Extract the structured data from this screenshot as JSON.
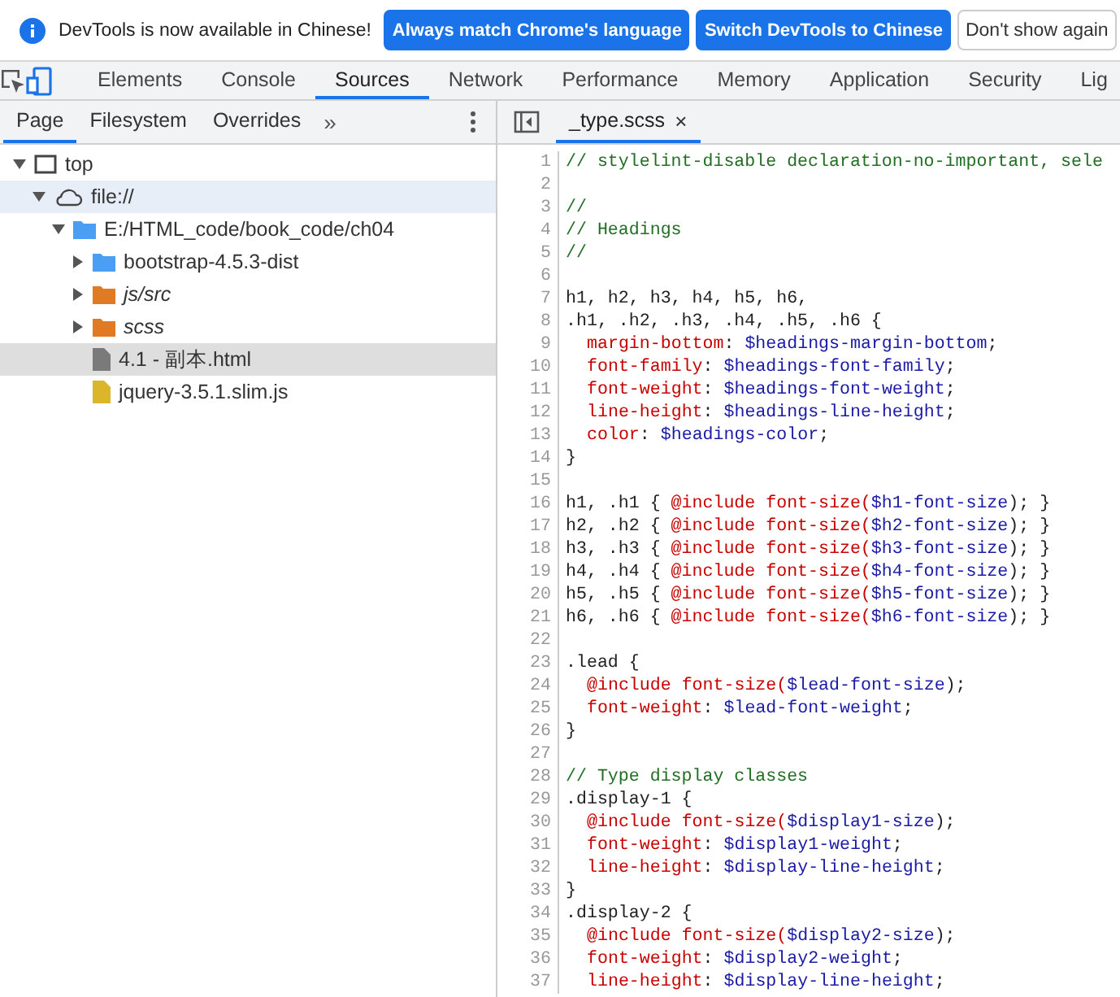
{
  "infobar": {
    "message": "DevTools is now available in Chinese!",
    "buttons": [
      {
        "label": "Always match Chrome's language",
        "kind": "primary"
      },
      {
        "label": "Switch DevTools to Chinese",
        "kind": "primary"
      },
      {
        "label": "Don't show again",
        "kind": "secondary"
      }
    ]
  },
  "main_tabs": [
    {
      "label": "Elements",
      "selected": false
    },
    {
      "label": "Console",
      "selected": false
    },
    {
      "label": "Sources",
      "selected": true
    },
    {
      "label": "Network",
      "selected": false
    },
    {
      "label": "Performance",
      "selected": false
    },
    {
      "label": "Memory",
      "selected": false
    },
    {
      "label": "Application",
      "selected": false
    },
    {
      "label": "Security",
      "selected": false
    },
    {
      "label": "Lig",
      "selected": false
    }
  ],
  "navigator": {
    "tabs": [
      {
        "label": "Page",
        "selected": true
      },
      {
        "label": "Filesystem",
        "selected": false
      },
      {
        "label": "Overrides",
        "selected": false
      }
    ],
    "more": "»",
    "tree": [
      {
        "kind": "frame",
        "label": "top",
        "expanded": true,
        "selected": false,
        "hovered": false,
        "italic": false,
        "children": [
          {
            "kind": "cloud",
            "label": "file://",
            "expanded": true,
            "selected": true,
            "hovered": false,
            "italic": false,
            "children": [
              {
                "kind": "folder",
                "label": "E:/HTML_code/book_code/ch04",
                "color": "#4a9ff5",
                "expanded": true,
                "selected": false,
                "hovered": false,
                "italic": false,
                "children": [
                  {
                    "kind": "folder",
                    "label": "bootstrap-4.5.3-dist",
                    "color": "#4a9ff5",
                    "expanded": false,
                    "selected": false,
                    "hovered": false,
                    "italic": false
                  },
                  {
                    "kind": "folder",
                    "label": "js/src",
                    "color": "#e07b24",
                    "expanded": false,
                    "selected": false,
                    "hovered": false,
                    "italic": true
                  },
                  {
                    "kind": "folder",
                    "label": "scss",
                    "color": "#e07b24",
                    "expanded": false,
                    "selected": false,
                    "hovered": false,
                    "italic": true
                  },
                  {
                    "kind": "file",
                    "label": "4.1 - 副本.html",
                    "color": "#7a7a7a",
                    "selected": false,
                    "hovered": true,
                    "italic": false
                  },
                  {
                    "kind": "file",
                    "label": "jquery-3.5.1.slim.js",
                    "color": "#dcb62a",
                    "selected": false,
                    "hovered": false,
                    "italic": false
                  }
                ]
              }
            ]
          }
        ]
      }
    ]
  },
  "editor": {
    "tabs": [
      {
        "label": "_type.scss",
        "close": "×",
        "selected": true
      }
    ],
    "lines": [
      {
        "number": "1",
        "tokens": [
          {
            "kind": "comment",
            "text": "// stylelint-disable declaration-no-important, sele"
          }
        ]
      },
      {
        "number": "2"
      },
      {
        "number": "3",
        "tokens": [
          {
            "kind": "comment",
            "text": "//"
          }
        ]
      },
      {
        "number": "4",
        "tokens": [
          {
            "kind": "comment",
            "text": "// Headings"
          }
        ]
      },
      {
        "number": "5",
        "tokens": [
          {
            "kind": "comment",
            "text": "//"
          }
        ]
      },
      {
        "number": "6"
      },
      {
        "number": "7",
        "tokens": [
          {
            "kind": "plain",
            "text": "h1, h2, h3, h4, h5, h6,"
          }
        ]
      },
      {
        "number": "8",
        "tokens": [
          {
            "kind": "plain",
            "text": ".h1, .h2, .h3, .h4, .h5, .h6 {"
          }
        ]
      },
      {
        "number": "9",
        "indented": true,
        "tokens": [
          {
            "kind": "property",
            "text": "margin-bottom"
          },
          {
            "kind": "plain",
            "text": ": "
          },
          {
            "kind": "variable",
            "text": "$headings-margin-bottom"
          },
          {
            "kind": "plain",
            "text": ";"
          }
        ]
      },
      {
        "number": "10",
        "indented": true,
        "tokens": [
          {
            "kind": "property",
            "text": "font-family"
          },
          {
            "kind": "plain",
            "text": ": "
          },
          {
            "kind": "variable",
            "text": "$headings-font-family"
          },
          {
            "kind": "plain",
            "text": ";"
          }
        ]
      },
      {
        "number": "11",
        "indented": true,
        "tokens": [
          {
            "kind": "property",
            "text": "font-weight"
          },
          {
            "kind": "plain",
            "text": ": "
          },
          {
            "kind": "variable",
            "text": "$headings-font-weight"
          },
          {
            "kind": "plain",
            "text": ";"
          }
        ]
      },
      {
        "number": "12",
        "indented": true,
        "tokens": [
          {
            "kind": "property",
            "text": "line-height"
          },
          {
            "kind": "plain",
            "text": ": "
          },
          {
            "kind": "variable",
            "text": "$headings-line-height"
          },
          {
            "kind": "plain",
            "text": ";"
          }
        ]
      },
      {
        "number": "13",
        "indented": true,
        "tokens": [
          {
            "kind": "property",
            "text": "color"
          },
          {
            "kind": "plain",
            "text": ": "
          },
          {
            "kind": "variable",
            "text": "$headings-color"
          },
          {
            "kind": "plain",
            "text": ";"
          }
        ]
      },
      {
        "number": "14",
        "tokens": [
          {
            "kind": "plain",
            "text": "}"
          }
        ]
      },
      {
        "number": "15"
      },
      {
        "number": "16",
        "tokens": [
          {
            "kind": "plain",
            "text": "h1, .h1 { "
          },
          {
            "kind": "property",
            "text": "@include font-size("
          },
          {
            "kind": "variable",
            "text": "$h1-font-size"
          },
          {
            "kind": "plain",
            "text": "); }"
          }
        ]
      },
      {
        "number": "17",
        "tokens": [
          {
            "kind": "plain",
            "text": "h2, .h2 { "
          },
          {
            "kind": "property",
            "text": "@include font-size("
          },
          {
            "kind": "variable",
            "text": "$h2-font-size"
          },
          {
            "kind": "plain",
            "text": "); }"
          }
        ]
      },
      {
        "number": "18",
        "tokens": [
          {
            "kind": "plain",
            "text": "h3, .h3 { "
          },
          {
            "kind": "property",
            "text": "@include font-size("
          },
          {
            "kind": "variable",
            "text": "$h3-font-size"
          },
          {
            "kind": "plain",
            "text": "); }"
          }
        ]
      },
      {
        "number": "19",
        "tokens": [
          {
            "kind": "plain",
            "text": "h4, .h4 { "
          },
          {
            "kind": "property",
            "text": "@include font-size("
          },
          {
            "kind": "variable",
            "text": "$h4-font-size"
          },
          {
            "kind": "plain",
            "text": "); }"
          }
        ]
      },
      {
        "number": "20",
        "tokens": [
          {
            "kind": "plain",
            "text": "h5, .h5 { "
          },
          {
            "kind": "property",
            "text": "@include font-size("
          },
          {
            "kind": "variable",
            "text": "$h5-font-size"
          },
          {
            "kind": "plain",
            "text": "); }"
          }
        ]
      },
      {
        "number": "21",
        "tokens": [
          {
            "kind": "plain",
            "text": "h6, .h6 { "
          },
          {
            "kind": "property",
            "text": "@include font-size("
          },
          {
            "kind": "variable",
            "text": "$h6-font-size"
          },
          {
            "kind": "plain",
            "text": "); }"
          }
        ]
      },
      {
        "number": "22"
      },
      {
        "number": "23",
        "tokens": [
          {
            "kind": "plain",
            "text": ".lead {"
          }
        ]
      },
      {
        "number": "24",
        "indented": true,
        "tokens": [
          {
            "kind": "property",
            "text": "@include font-size("
          },
          {
            "kind": "variable",
            "text": "$lead-font-size"
          },
          {
            "kind": "plain",
            "text": ");"
          }
        ]
      },
      {
        "number": "25",
        "indented": true,
        "tokens": [
          {
            "kind": "property",
            "text": "font-weight"
          },
          {
            "kind": "plain",
            "text": ": "
          },
          {
            "kind": "variable",
            "text": "$lead-font-weight"
          },
          {
            "kind": "plain",
            "text": ";"
          }
        ]
      },
      {
        "number": "26",
        "tokens": [
          {
            "kind": "plain",
            "text": "}"
          }
        ]
      },
      {
        "number": "27"
      },
      {
        "number": "28",
        "tokens": [
          {
            "kind": "comment",
            "text": "// Type display classes"
          }
        ]
      },
      {
        "number": "29",
        "tokens": [
          {
            "kind": "plain",
            "text": ".display-1 {"
          }
        ]
      },
      {
        "number": "30",
        "indented": true,
        "tokens": [
          {
            "kind": "property",
            "text": "@include font-size("
          },
          {
            "kind": "variable",
            "text": "$display1-size"
          },
          {
            "kind": "plain",
            "text": ");"
          }
        ]
      },
      {
        "number": "31",
        "indented": true,
        "tokens": [
          {
            "kind": "property",
            "text": "font-weight"
          },
          {
            "kind": "plain",
            "text": ": "
          },
          {
            "kind": "variable",
            "text": "$display1-weight"
          },
          {
            "kind": "plain",
            "text": ";"
          }
        ]
      },
      {
        "number": "32",
        "indented": true,
        "tokens": [
          {
            "kind": "property",
            "text": "line-height"
          },
          {
            "kind": "plain",
            "text": ": "
          },
          {
            "kind": "variable",
            "text": "$display-line-height"
          },
          {
            "kind": "plain",
            "text": ";"
          }
        ]
      },
      {
        "number": "33",
        "tokens": [
          {
            "kind": "plain",
            "text": "}"
          }
        ]
      },
      {
        "number": "34",
        "tokens": [
          {
            "kind": "plain",
            "text": ".display-2 {"
          }
        ]
      },
      {
        "number": "35",
        "indented": true,
        "tokens": [
          {
            "kind": "property",
            "text": "@include font-size("
          },
          {
            "kind": "variable",
            "text": "$display2-size"
          },
          {
            "kind": "plain",
            "text": ");"
          }
        ]
      },
      {
        "number": "36",
        "indented": true,
        "tokens": [
          {
            "kind": "property",
            "text": "font-weight"
          },
          {
            "kind": "plain",
            "text": ": "
          },
          {
            "kind": "variable",
            "text": "$display2-weight"
          },
          {
            "kind": "plain",
            "text": ";"
          }
        ]
      },
      {
        "number": "37",
        "indented": true,
        "tokens": [
          {
            "kind": "property",
            "text": "line-height"
          },
          {
            "kind": "plain",
            "text": ": "
          },
          {
            "kind": "variable",
            "text": "$display-line-height"
          },
          {
            "kind": "plain",
            "text": ";"
          }
        ]
      }
    ]
  }
}
